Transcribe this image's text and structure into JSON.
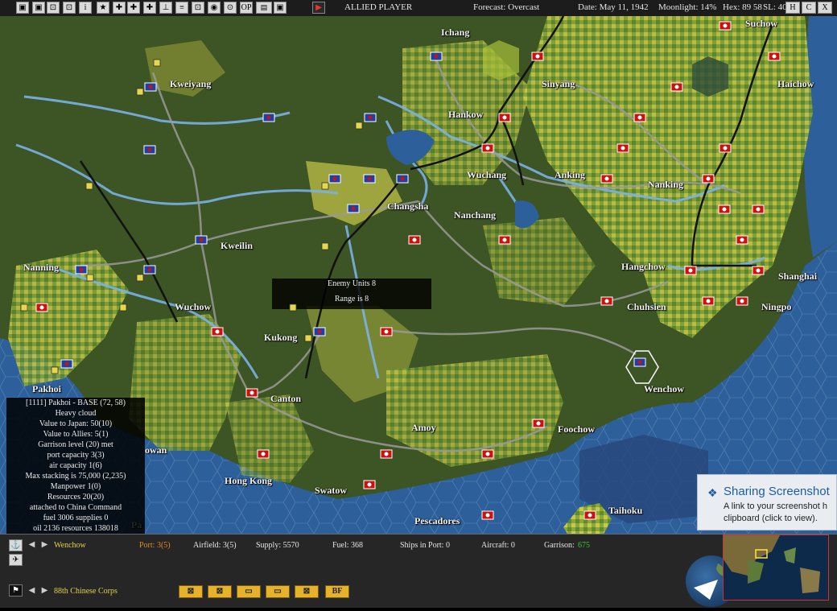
{
  "toolbar": {
    "buttons": [
      "▣",
      "▣",
      "⊡",
      "⊡",
      "i",
      "★",
      "✚",
      "✚",
      "✚",
      "⊥",
      "≡",
      "⊡",
      "◉",
      "⊙",
      "OP",
      "▤",
      "▣"
    ],
    "end_turn": "▶",
    "player": "ALLIED PLAYER",
    "forecast": "Forecast: Overcast",
    "date": "Date: May 11, 1942",
    "moonlight": "Moonlight: 14%",
    "hex": "Hex: 89  58",
    "sl": "SL: 40",
    "help_btn": "H",
    "c_btn": "C",
    "x_btn": "X"
  },
  "map": {
    "cities": [
      "Ichang",
      "Suchow",
      "Kweiyang",
      "Sinyang",
      "Haichow",
      "Hankow",
      "Wuchang",
      "Anking",
      "Nanking",
      "Changsha",
      "Nanchang",
      "Kweilin",
      "Nanning",
      "Hangchow",
      "Shanghai",
      "Wuchow",
      "Chuhsien",
      "Ningpo",
      "Kukong",
      "Wenchow",
      "Pakhoi",
      "Canton",
      "Foochow",
      "Amoy",
      "Hong Kong",
      "Swatow",
      "Taihoku",
      "Pescadores"
    ],
    "partial_label": "owan",
    "partial_label_2": "Pa"
  },
  "tooltip": {
    "line1": "Enemy Units 8",
    "line2": "Range is 8"
  },
  "info_panel": {
    "lines": [
      "[1111] Pakhoi - BASE (72, 58)",
      "Heavy cloud",
      "Value to Japan: 50(10)",
      "Value to Allies: 5(1)",
      "Garrison level (20) met",
      "port capacity 3(3)",
      "air capacity 1(6)",
      "Max stacking is 75,000 (2,235)",
      "Manpower 1(0)",
      "Resources 20(20)",
      "attached to China Command",
      "fuel 3006  supplies 0",
      "oil 2136  resources 138018"
    ]
  },
  "notification": {
    "title": "Sharing Screenshot",
    "body": "A link to your screenshot h clipboard (click to view)."
  },
  "status": {
    "location": "Wenchow",
    "port": "Port: 3(5)",
    "airfield": "Airfield: 3(5)",
    "supply": "Supply: 5570",
    "fuel": "Fuel: 368",
    "ships": "Ships in Port: 0",
    "aircraft": "Aircraft: 0",
    "garrison_label": "Garrison:",
    "garrison_value": "675"
  },
  "unit_bar": {
    "unit": "88th Chinese Corps",
    "buttons": [
      "⊠",
      "⊠",
      "▭",
      "▭",
      "⊠",
      "BF"
    ]
  },
  "colors": {
    "land_green": "#5a7a2a",
    "land_yellow": "#c8c64a",
    "sea": "#2d5f9a",
    "river": "#7ab2e8",
    "road": "#9a9a9a",
    "rail": "#111111",
    "allied_flag": "#1f3fa8",
    "japan_flag": "#cc1111",
    "garrison_green": "#33cc33",
    "port_orange": "#e08a2a",
    "location_yellow": "#e0d24a"
  }
}
